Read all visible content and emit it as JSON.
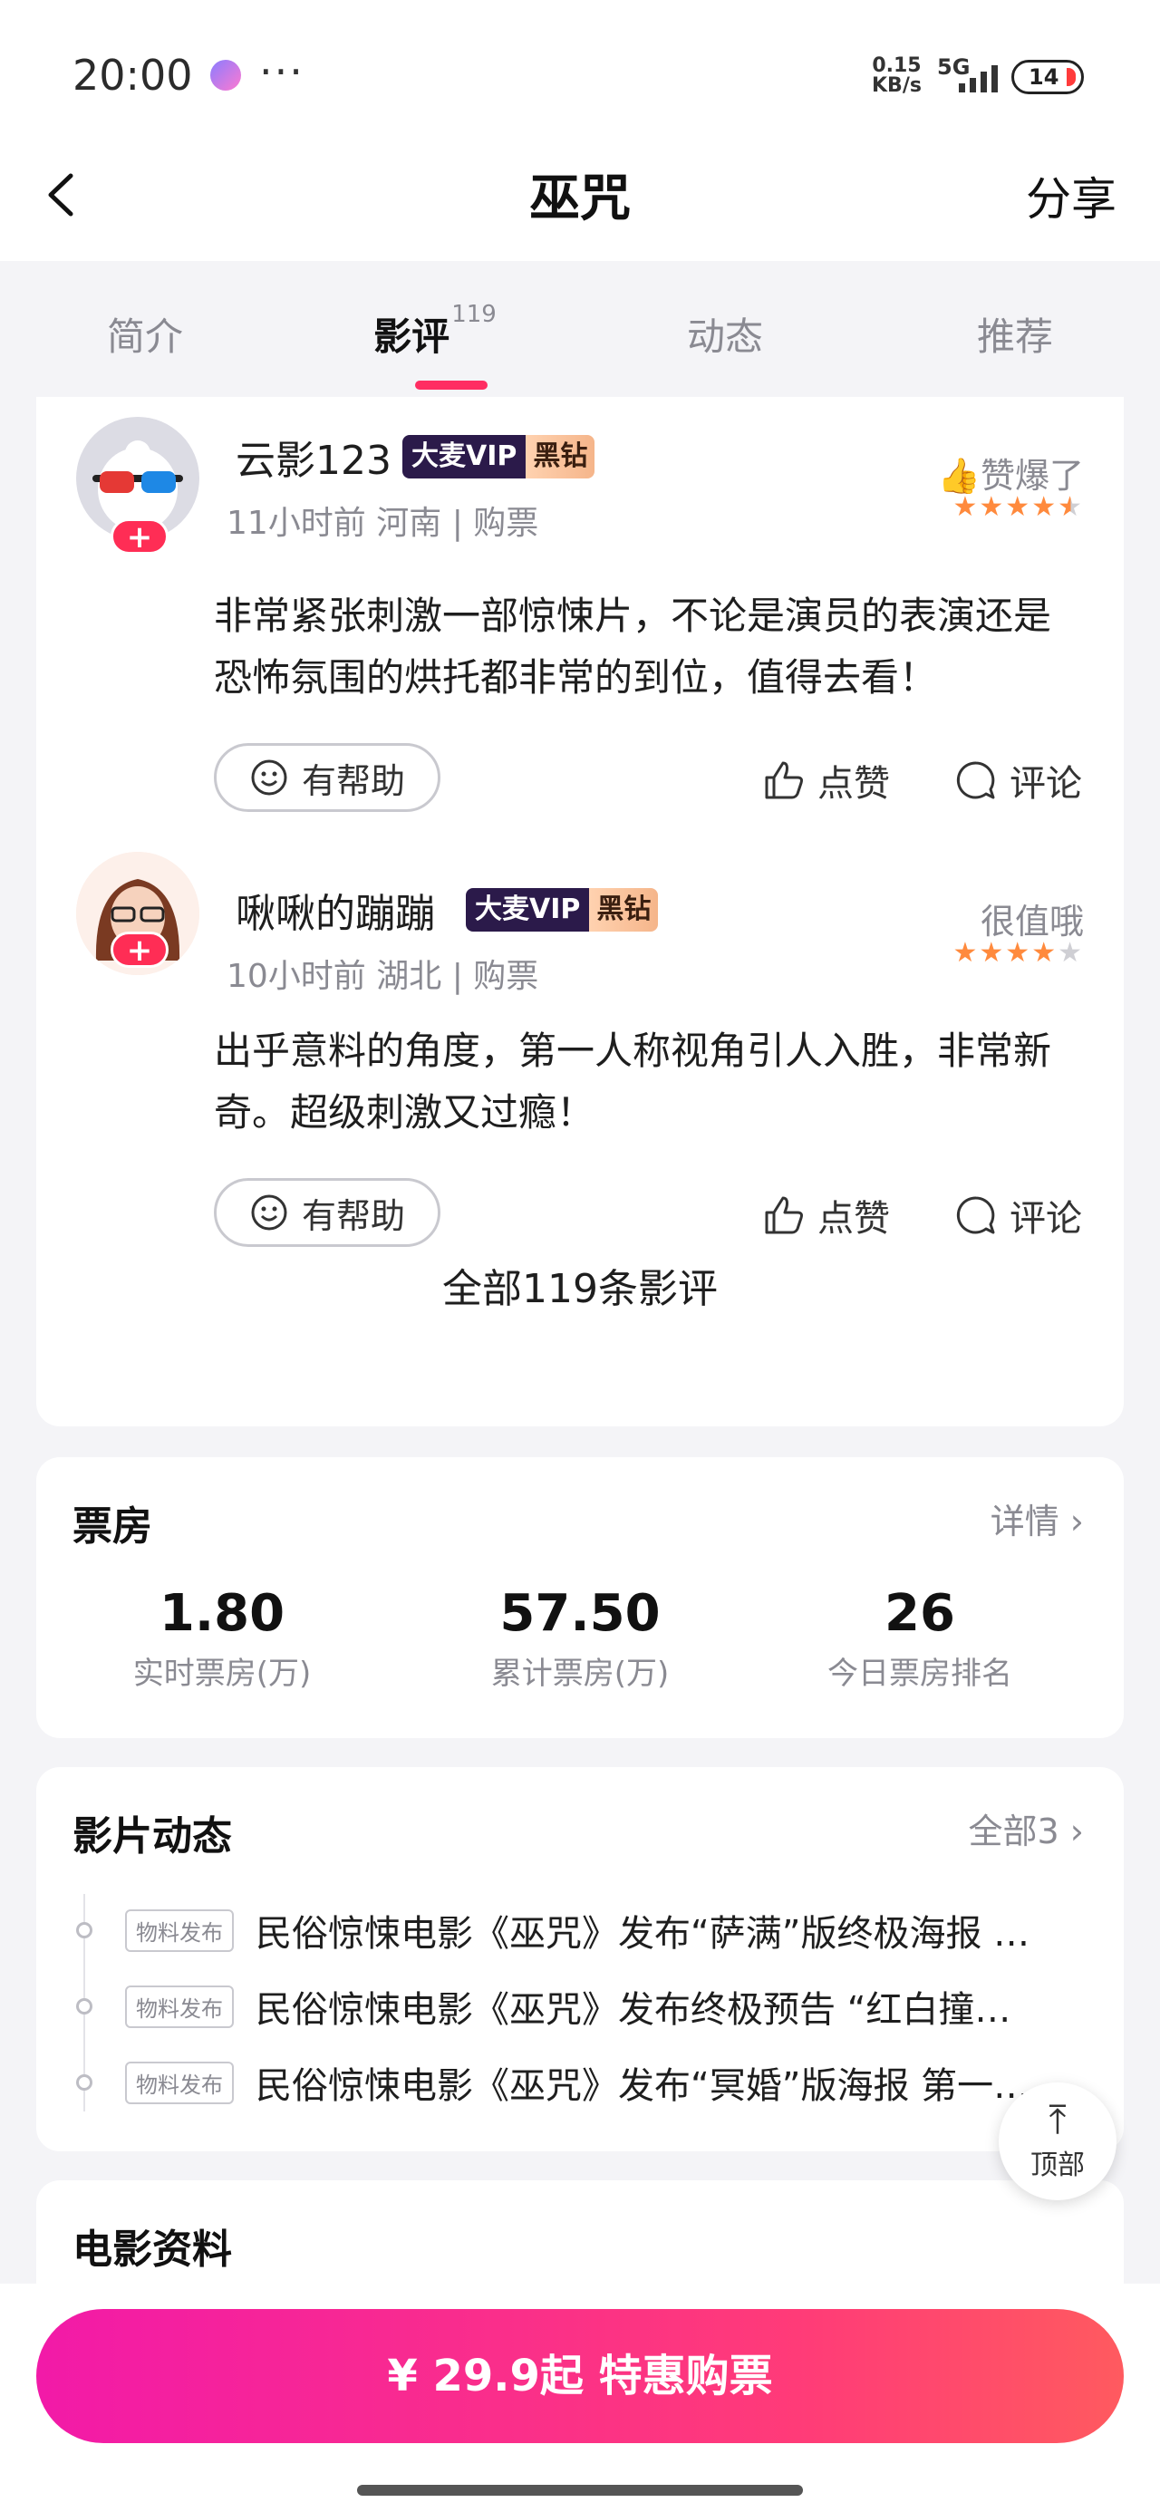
{
  "status_bar": {
    "time": "20:00",
    "dots": "···",
    "speed_value": "0.15",
    "speed_unit": "KB/s",
    "network": "5G",
    "battery": "14"
  },
  "nav": {
    "title": "巫咒",
    "share": "分享"
  },
  "tabs": [
    {
      "label": "简介"
    },
    {
      "label": "影评",
      "count": "119"
    },
    {
      "label": "动态"
    },
    {
      "label": "推荐"
    }
  ],
  "reviews": [
    {
      "username": "云影123",
      "vip_a": "大麦VIP",
      "vip_b": "黑钻",
      "meta": "11小时前 河南 | 购票",
      "rating_label": "👍赞爆了",
      "stars": 4.5,
      "text": "非常紧张刺激一部惊悚片，不论是演员的表演还是恐怖氛围的烘托都非常的到位，值得去看！",
      "helpful": "有帮助",
      "like": "点赞",
      "comment": "评论"
    },
    {
      "username": "啾啾的蹦蹦",
      "vip_a": "大麦VIP",
      "vip_b": "黑钻",
      "meta": "10小时前 湖北 | 购票",
      "rating_label": "很值哦",
      "stars": 4,
      "text": "出乎意料的角度，第一人称视角引人入胜，非常新奇。超级刺激又过瘾！",
      "helpful": "有帮助",
      "like": "点赞",
      "comment": "评论"
    }
  ],
  "all_reviews": "全部119条影评",
  "box_office": {
    "title": "票房",
    "more": "详情 ›",
    "stats": [
      {
        "value": "1.80",
        "label": "实时票房(万)"
      },
      {
        "value": "57.50",
        "label": "累计票房(万)"
      },
      {
        "value": "26",
        "label": "今日票房排名"
      }
    ]
  },
  "news": {
    "title": "影片动态",
    "more": "全部3 ›",
    "items": [
      {
        "tag": "物料发布",
        "text": "民俗惊悚电影《巫咒》发布“萨满”版终极海报 …"
      },
      {
        "tag": "物料发布",
        "text": "民俗惊悚电影《巫咒》发布终极预告 “红白撞…"
      },
      {
        "tag": "物料发布",
        "text": "民俗惊悚电影《巫咒》发布“冥婚”版海报 第一…"
      }
    ]
  },
  "info": {
    "title": "电影资料"
  },
  "to_top": {
    "label": "顶部"
  },
  "buy": {
    "label": "¥ 29.9起  特惠购票"
  },
  "colors": {
    "accent": "#ff2d62",
    "star": "#ff8a3d",
    "vip_dark": "#2b1a4a"
  }
}
